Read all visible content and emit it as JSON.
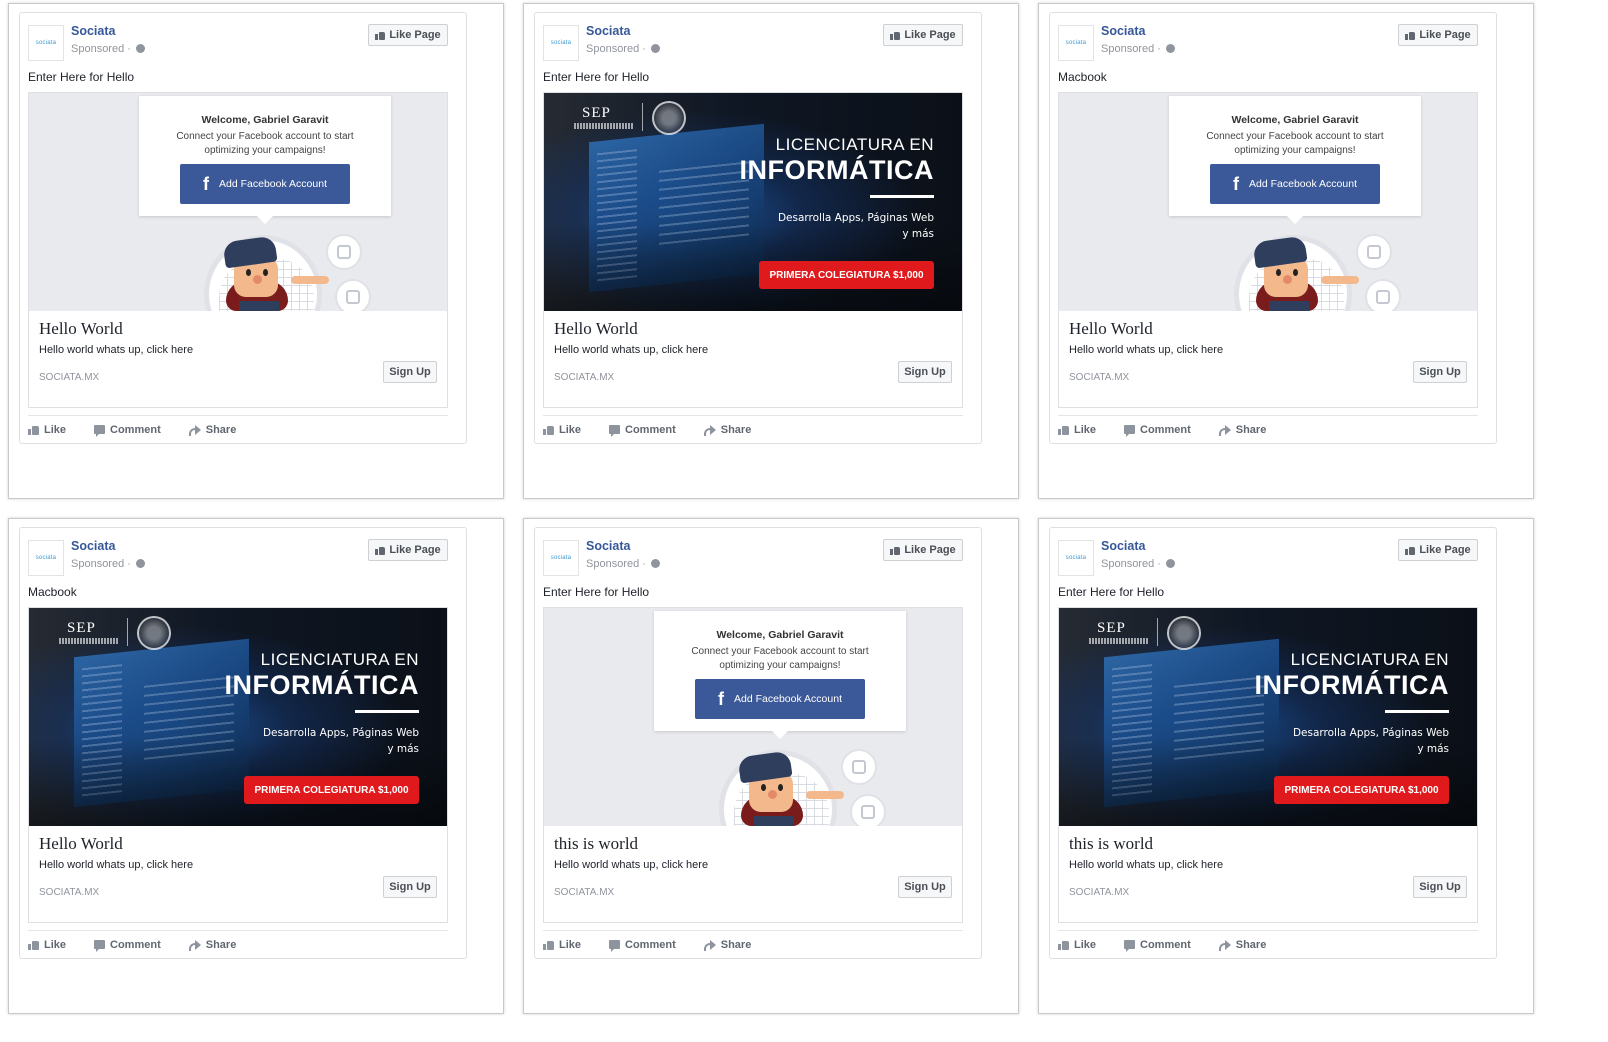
{
  "page": {
    "name": "Sociata",
    "sponsored": "Sponsored ·",
    "like_page": "Like Page",
    "logo_text": "sociata"
  },
  "actions": {
    "like": "Like",
    "comment": "Comment",
    "share": "Share"
  },
  "creatives": {
    "welcome": {
      "title": "Welcome, Gabriel Garavit",
      "subtitle": "Connect your Facebook account to start optimizing your campaigns!",
      "button": "Add Facebook Account",
      "button_icon": "f"
    },
    "sep": {
      "logo": "SEP",
      "line1": "LICENCIATURA EN",
      "line2": "INFORMÁTICA",
      "line3a": "Desarrolla Apps, Páginas Web",
      "line3b": "y más",
      "cta": "PRIMERA COLEGIATURA $1,000"
    }
  },
  "ads": [
    {
      "text": "Enter Here for Hello",
      "creative": "welcome",
      "headline": "Hello World",
      "description": "Hello world whats up, click here",
      "domain": "SOCIATA.MX",
      "cta": "Sign Up"
    },
    {
      "text": "Enter Here for Hello",
      "creative": "sep",
      "headline": "Hello World",
      "description": "Hello world whats up, click here",
      "domain": "SOCIATA.MX",
      "cta": "Sign Up"
    },
    {
      "text": "Macbook",
      "creative": "welcome",
      "headline": "Hello World",
      "description": "Hello world whats up, click here",
      "domain": "SOCIATA.MX",
      "cta": "Sign Up"
    },
    {
      "text": "Macbook",
      "creative": "sep",
      "headline": "Hello World",
      "description": "Hello world whats up, click here",
      "domain": "SOCIATA.MX",
      "cta": "Sign Up"
    },
    {
      "text": "Enter Here for Hello",
      "creative": "welcome",
      "headline": "this is world",
      "description": "Hello world whats up, click here",
      "domain": "SOCIATA.MX",
      "cta": "Sign Up"
    },
    {
      "text": "Enter Here for Hello",
      "creative": "sep",
      "headline": "this is world",
      "description": "Hello world whats up, click here",
      "domain": "SOCIATA.MX",
      "cta": "Sign Up"
    }
  ],
  "colors": {
    "link_blue": "#365899",
    "fb_blue": "#3b5998",
    "cta_red": "#e0191c"
  }
}
